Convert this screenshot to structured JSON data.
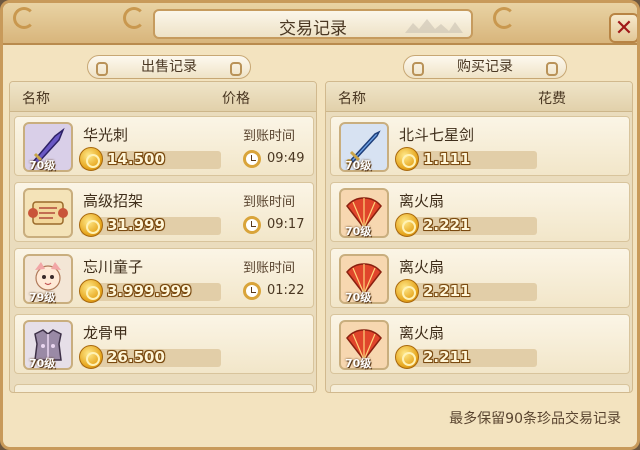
{
  "window": {
    "title": "交易记录",
    "close_glyph": "✕"
  },
  "sell": {
    "tab_label": "出售记录",
    "col_name": "名称",
    "col_price": "价格",
    "rows": [
      {
        "name": "华光刺",
        "level": "70级",
        "price": "14.500",
        "arrival_label": "到账时间",
        "time": "09:49",
        "icon": "dagger-icon",
        "bg": "#d9cfe8"
      },
      {
        "name": "高级招架",
        "level": "",
        "price": "31.999",
        "arrival_label": "到账时间",
        "time": "09:17",
        "icon": "scroll-icon",
        "bg": "#f4e3b8"
      },
      {
        "name": "忘川童子",
        "level": "79级",
        "price": "3.999.999",
        "arrival_label": "到账时间",
        "time": "01:22",
        "icon": "child-spirit-icon",
        "bg": "#f3e6d6"
      },
      {
        "name": "龙骨甲",
        "level": "70级",
        "price": "26.500",
        "arrival_label": "",
        "time": "",
        "icon": "armor-icon",
        "bg": "#e6dfe8"
      }
    ]
  },
  "buy": {
    "tab_label": "购买记录",
    "col_name": "名称",
    "col_cost": "花费",
    "rows": [
      {
        "name": "北斗七星剑",
        "level": "70级",
        "price": "1.111",
        "icon": "sword-icon",
        "bg": "#d7e2f2"
      },
      {
        "name": "离火扇",
        "level": "70级",
        "price": "2.221",
        "icon": "fire-fan-icon",
        "bg": "#f7d7b0"
      },
      {
        "name": "离火扇",
        "level": "70级",
        "price": "2.211",
        "icon": "fire-fan-icon",
        "bg": "#f7d7b0"
      },
      {
        "name": "离火扇",
        "level": "70级",
        "price": "2.211",
        "icon": "fire-fan-icon",
        "bg": "#f7d7b0"
      }
    ]
  },
  "footer_note": "最多保留90条珍品交易记录",
  "colors": {
    "frame": "#f3e3bf",
    "border": "#c89a5a",
    "close_x": "#a01818",
    "coin": "#e6a51c"
  }
}
